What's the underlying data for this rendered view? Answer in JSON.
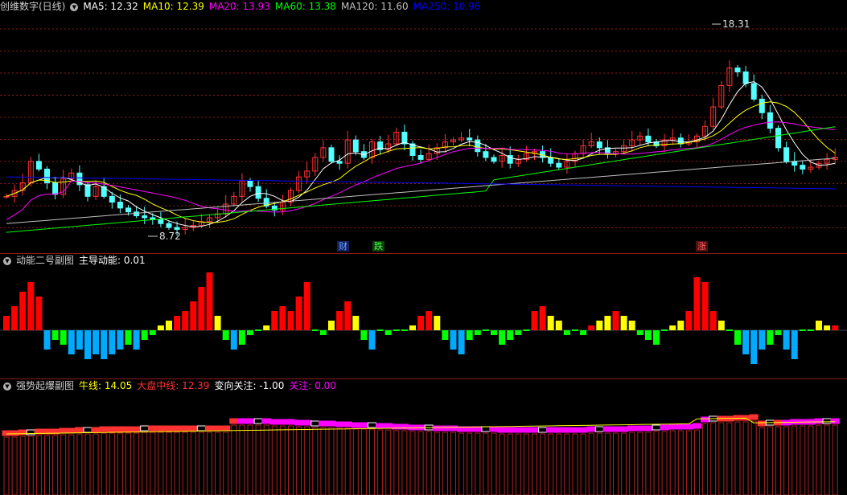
{
  "main": {
    "title": "创维数字(日线)",
    "ma": [
      {
        "label": "MA5: 12.32",
        "color": "#ffffff"
      },
      {
        "label": "MA10: 12.39",
        "color": "#ffff00"
      },
      {
        "label": "MA20: 13.93",
        "color": "#ff00ff"
      },
      {
        "label": "MA60: 13.38",
        "color": "#00ff00"
      },
      {
        "label": "MA120: 11.60",
        "color": "#c0c0c0"
      },
      {
        "label": "MA250: 10.96",
        "color": "#0000ff"
      }
    ],
    "high_label": "18.31",
    "low_label": "8.72",
    "tags": {
      "cai": "财",
      "die": "跌",
      "zhang": "涨"
    },
    "colors": {
      "up": "#ff3232",
      "down": "#54ffff"
    }
  },
  "sub1": {
    "title": "动能二号副图",
    "label": "主导动能: 0.01",
    "values": [
      3,
      5,
      8,
      10,
      7,
      -4,
      -2,
      -3,
      -5,
      -4,
      -6,
      -5,
      -6,
      -5,
      -4,
      -3,
      -4,
      -2,
      -1,
      1,
      2,
      3,
      4,
      6,
      9,
      12,
      3,
      -2,
      -4,
      -3,
      -1,
      0,
      1,
      4,
      5,
      4,
      7,
      10,
      0,
      -1,
      2,
      4,
      6,
      3,
      -2,
      -4,
      0,
      -1,
      0,
      0,
      1,
      3,
      4,
      3,
      -2,
      -4,
      -5,
      -2,
      -1,
      0,
      -1,
      -3,
      -2,
      -1,
      0,
      4,
      5,
      3,
      2,
      -1,
      0,
      -1,
      1,
      2,
      3,
      4,
      3,
      2,
      -1,
      -2,
      -3,
      0,
      1,
      2,
      4,
      11,
      10,
      4,
      2,
      0,
      -3,
      -5,
      -7,
      -4,
      -3,
      -1,
      -4,
      -6,
      0,
      0,
      2,
      1,
      1
    ],
    "colors": {
      "strong_up": "#ff0000",
      "weak_up": "#ffff00",
      "weak_down": "#00ff00",
      "strong_down": "#00aaff"
    }
  },
  "sub2": {
    "title": "强势起爆副图",
    "items": [
      {
        "label": "牛线: 14.05",
        "color": "#ffff00"
      },
      {
        "label": "大盘中线: 12.39",
        "color": "#ff3232"
      },
      {
        "label": "变向关注: -1.00",
        "color": "#ffffff"
      },
      {
        "label": "关注: 0.00",
        "color": "#ff00ff"
      }
    ]
  }
}
